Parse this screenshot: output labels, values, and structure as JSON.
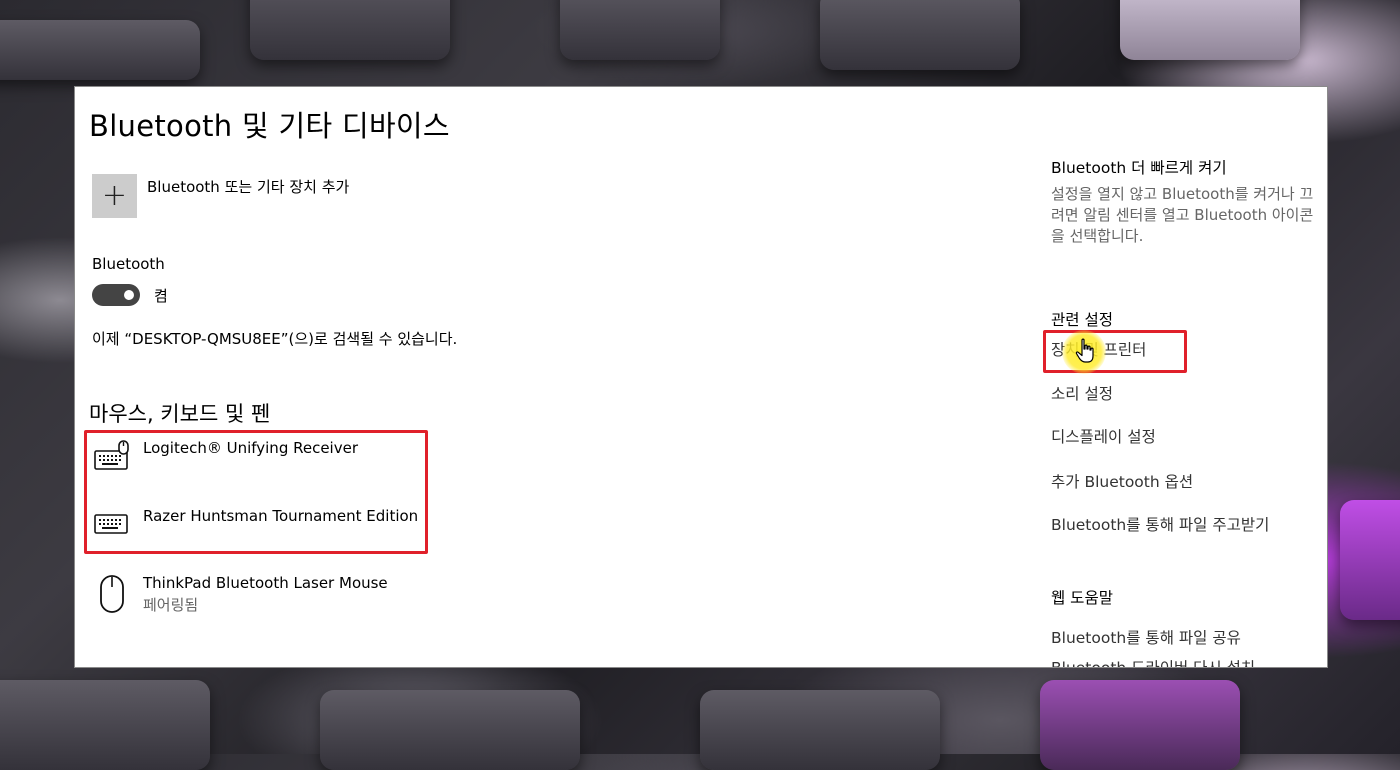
{
  "page_title": "Bluetooth 및 기타 디바이스",
  "add_device_label": "Bluetooth 또는 기타 장치 추가",
  "add_device_icon": "plus-icon",
  "bluetooth_label": "Bluetooth",
  "bluetooth_toggle_state": "켬",
  "bluetooth_toggle_on": true,
  "discoverable_text": "이제 “DESKTOP-QMSU8EE”(으)로 검색될 수 있습니다.",
  "section_title": "마우스, 키보드 및 펜",
  "devices": [
    {
      "name": "Logitech® Unifying Receiver",
      "status": "",
      "icon": "keyboard-mouse-icon"
    },
    {
      "name": "Razer Huntsman Tournament Edition",
      "status": "",
      "icon": "keyboard-icon"
    },
    {
      "name": "ThinkPad Bluetooth Laser Mouse",
      "status": "페어링됨",
      "icon": "mouse-icon"
    }
  ],
  "sidebar": {
    "quick_title": "Bluetooth 더 빠르게 켜기",
    "quick_text": "설정을 열지 않고 Bluetooth를 켜거나 끄려면 알림 센터를 열고 Bluetooth 아이콘을 선택합니다.",
    "related_title": "관련 설정",
    "related_links": [
      "장치 및 프린터",
      "소리 설정",
      "디스플레이 설정",
      "추가 Bluetooth 옵션",
      "Bluetooth를 통해 파일 주고받기"
    ],
    "web_help_title": "웹 도움말",
    "web_help_links": [
      "Bluetooth를 통해 파일 공유",
      "Bluetooth 드라이버 다시 설치"
    ]
  },
  "colors": {
    "highlight": "#e0202a",
    "cursor_glow": "#ffeb28",
    "toggle_on": "#444444"
  }
}
